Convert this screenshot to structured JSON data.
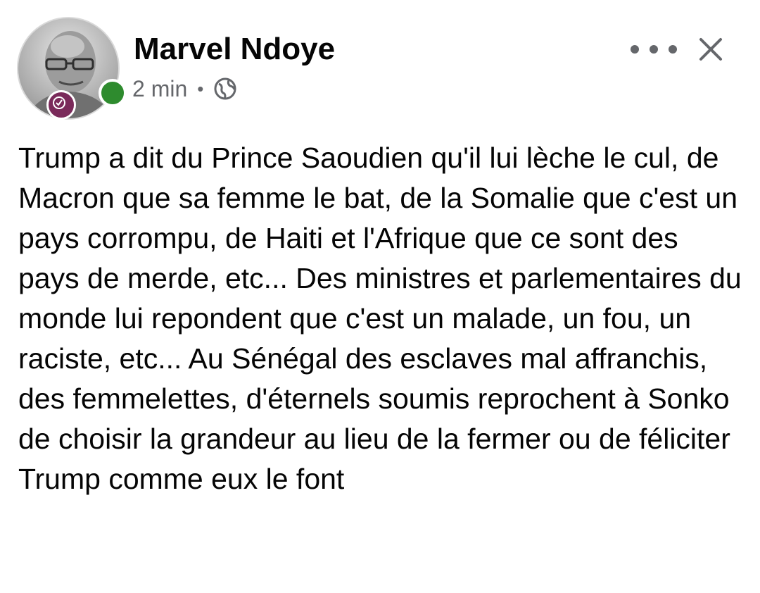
{
  "post": {
    "author_name": "Marvel Ndoye",
    "timestamp": "2 min",
    "separator": "•",
    "audience_icon": "globe-icon",
    "more_icon": "more-horizontal-icon",
    "close_icon": "close-icon",
    "online_status_color": "#2e8b2e",
    "text": "Trump a dit du Prince Saoudien qu'il lui lèche le cul, de Macron que sa femme le bat, de la Somalie que c'est un pays corrompu, de Haiti et l'Afrique que ce sont des pays de merde, etc... Des ministres et parlementaires du monde lui repondent que c'est un malade, un fou, un raciste, etc... Au Sénégal des esclaves mal affranchis, des femmelettes, d'éternels soumis reprochent à Sonko de choisir la grandeur au lieu de la fermer ou de féliciter Trump comme eux le font"
  }
}
